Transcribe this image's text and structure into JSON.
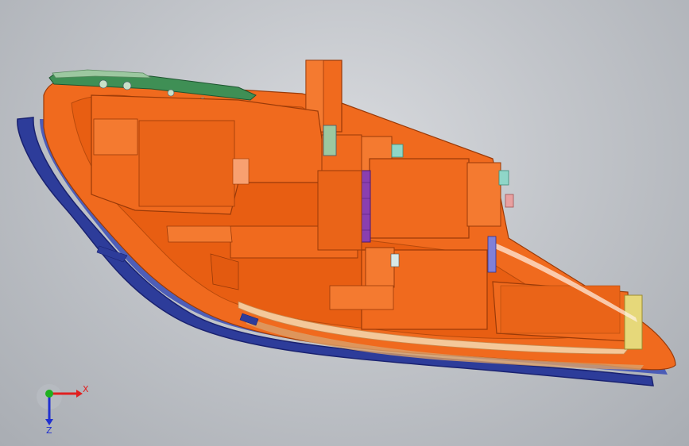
{
  "colors": {
    "background_center": "#d8dade",
    "background_edge": "#a9adb3",
    "housing": "#f06a1e",
    "housing_shadow": "#c84e0e",
    "housing_dark": "#9a3a08",
    "lens": "#2d3c9a",
    "lens_dark": "#1a2270",
    "pcb": "#3f8f55",
    "pcb_light": "#9cc8a0",
    "gear_purple": "#8a3fb0",
    "connector_yellow": "#e6d87a",
    "bulb_teal": "#8fd6c8",
    "bulb_pink": "#e8a0a0",
    "axis_x": "#e02020",
    "axis_y": "#20b020",
    "axis_z": "#2030d0"
  },
  "triad": {
    "x_label": "X",
    "z_label": "Z"
  }
}
